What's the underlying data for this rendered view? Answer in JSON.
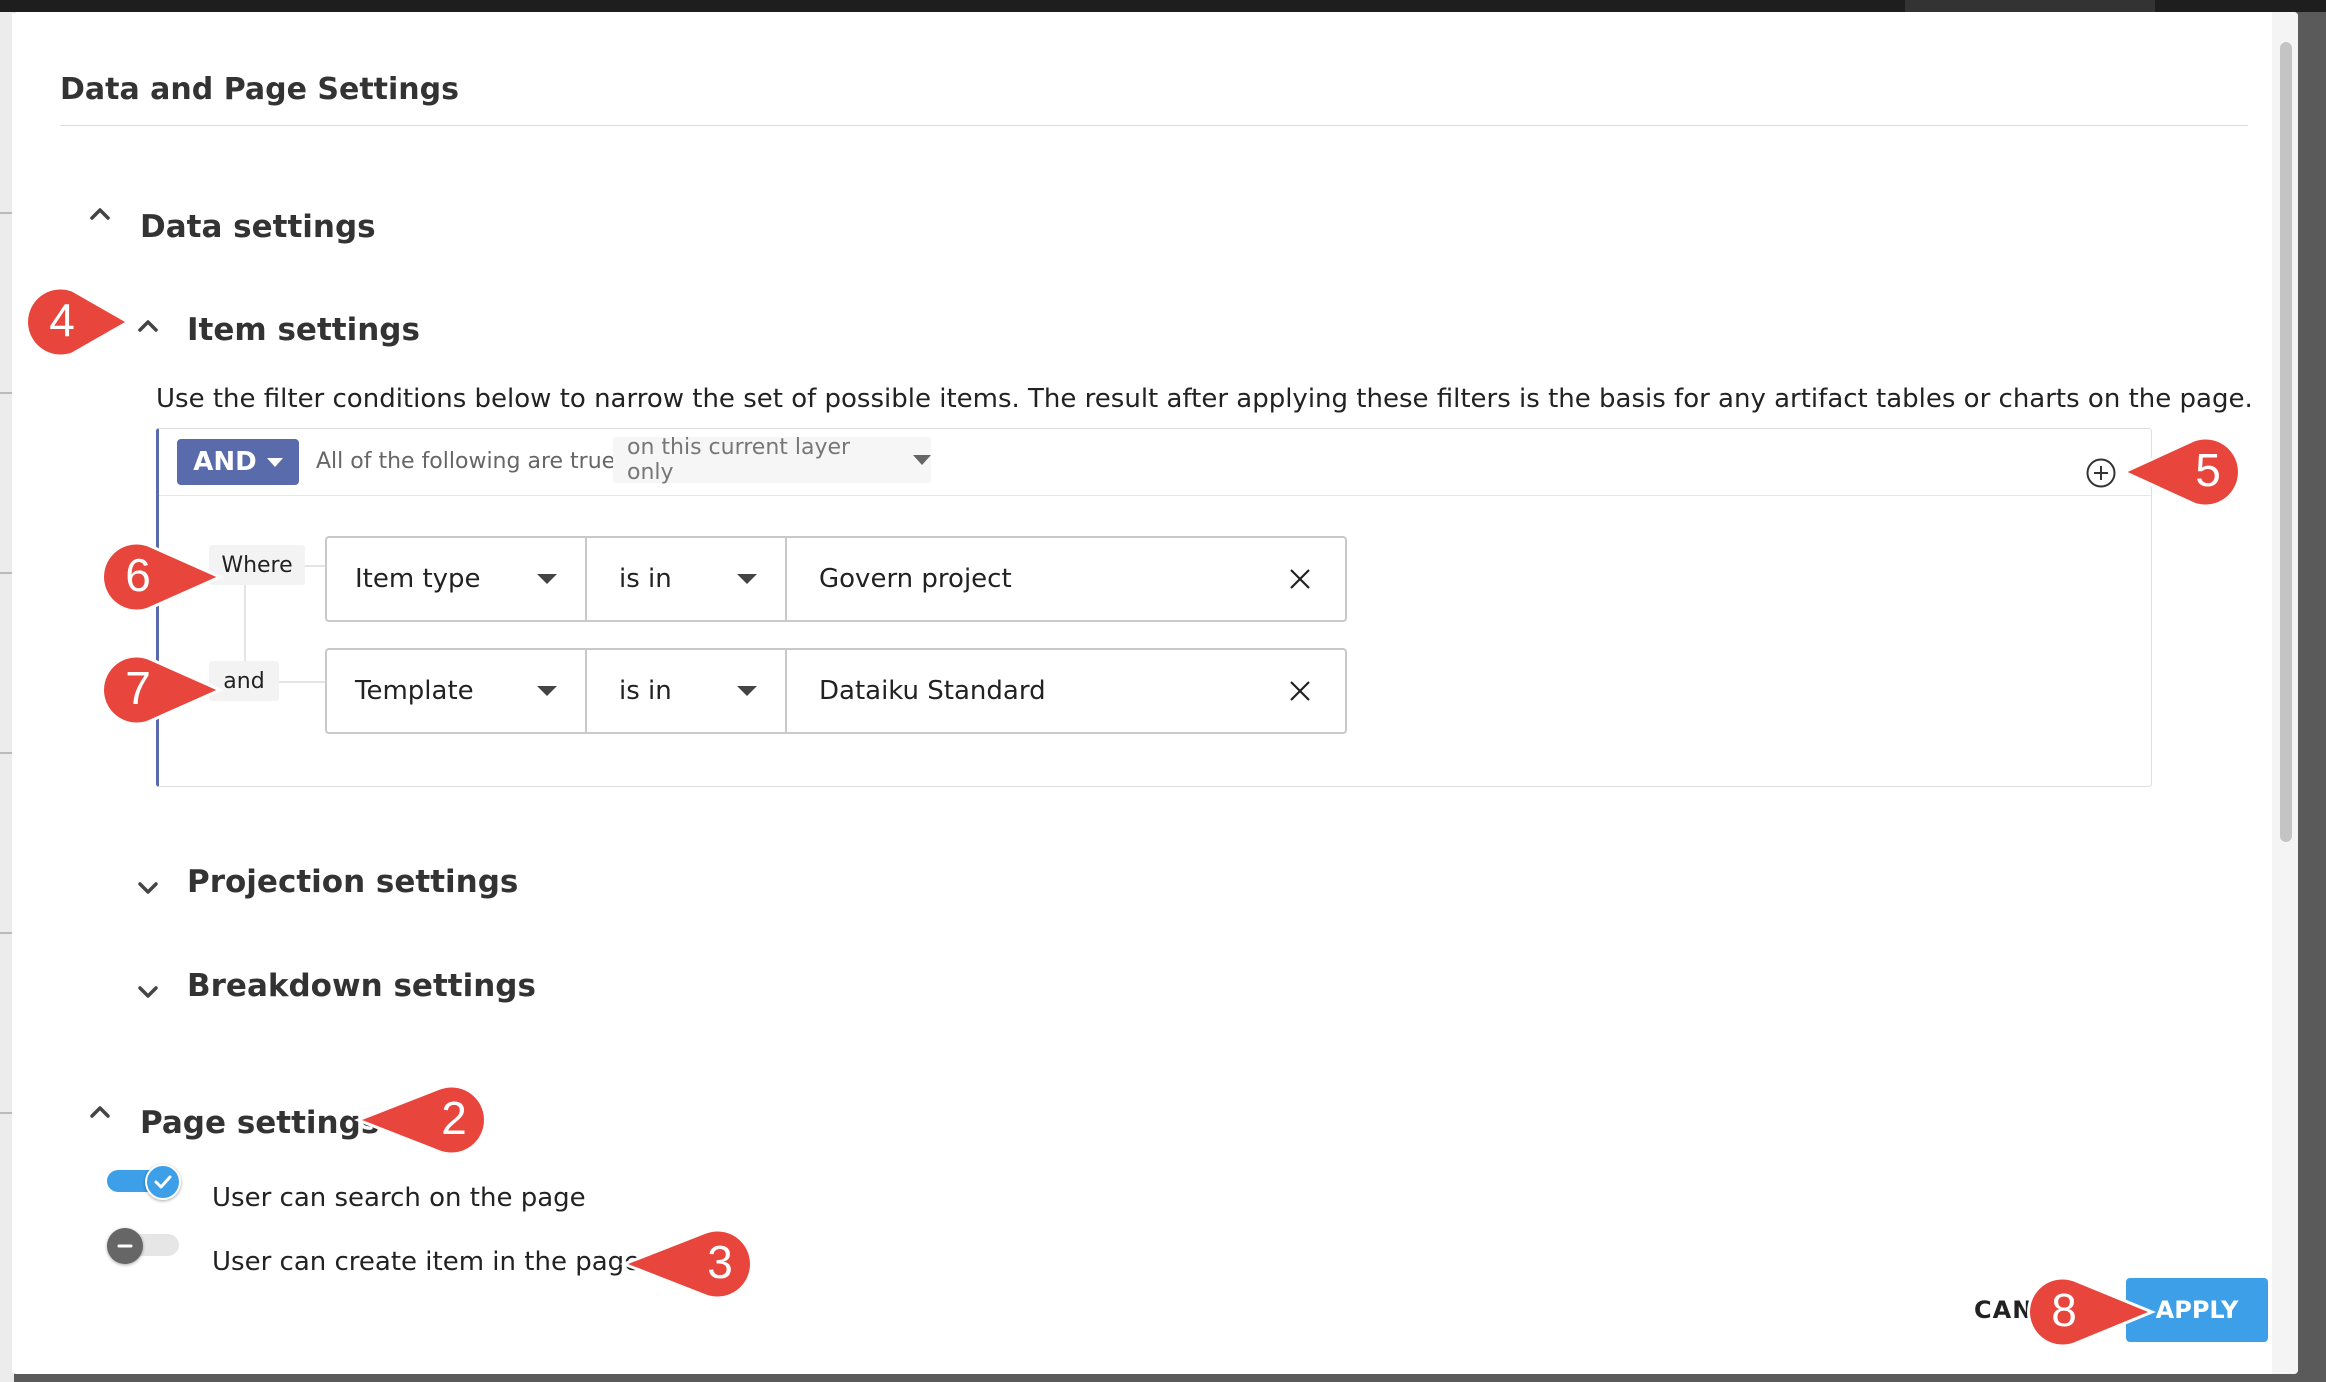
{
  "modal": {
    "title": "Data and Page Settings"
  },
  "data_settings": {
    "label": "Data settings",
    "item_settings": {
      "label": "Item settings",
      "description": "Use the filter conditions below to narrow the set of possible items. The result after applying these filters is the basis for any artifact tables or charts on the page.",
      "filter": {
        "operator": "AND",
        "operator_desc": "All of the following are true",
        "layer_scope": "on this current layer only",
        "conditions": [
          {
            "conjunction": "Where",
            "field": "Item type",
            "operator": "is in",
            "value": "Govern project"
          },
          {
            "conjunction": "and",
            "field": "Template",
            "operator": "is in",
            "value": "Dataiku Standard"
          }
        ]
      }
    },
    "projection_settings": {
      "label": "Projection settings"
    },
    "breakdown_settings": {
      "label": "Breakdown settings"
    }
  },
  "page_settings": {
    "label": "Page settings",
    "toggles": [
      {
        "label": "User can search on the page",
        "on": true
      },
      {
        "label": "User can create item in the page",
        "on": false
      }
    ]
  },
  "footer": {
    "cancel_label": "CANCEL",
    "apply_label": "APPLY"
  },
  "callouts": [
    "4",
    "5",
    "6",
    "7",
    "2",
    "3",
    "8"
  ],
  "colors": {
    "accent": "#5a6bab",
    "apply": "#3d9fe8",
    "callout": "#e8453c",
    "toggle_on": "#3d9fe8"
  }
}
